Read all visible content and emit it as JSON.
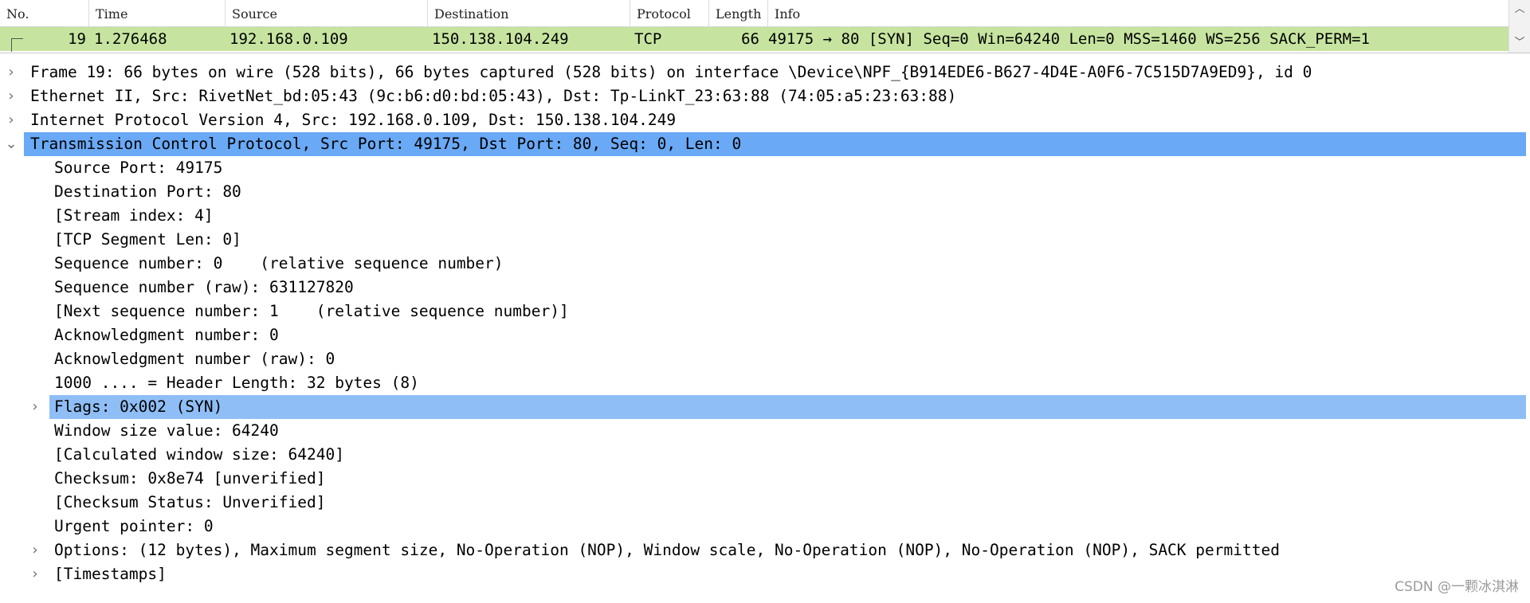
{
  "packet_list": {
    "columns": [
      "No.",
      "Time",
      "Source",
      "Destination",
      "Protocol",
      "Length",
      "Info"
    ],
    "row": {
      "no": "19",
      "time": "1.276468",
      "source": "192.168.0.109",
      "destination": "150.138.104.249",
      "protocol": "TCP",
      "length": "66",
      "info": "49175 → 80 [SYN] Seq=0 Win=64240 Len=0 MSS=1460 WS=256 SACK_PERM=1"
    },
    "row_color": "#c6e4a0",
    "scroll_up_icon": "chevron-up-icon",
    "scroll_down_icon": "chevron-down-icon"
  },
  "details": {
    "frame": "Frame 19: 66 bytes on wire (528 bits), 66 bytes captured (528 bits) on interface \\Device\\NPF_{B914EDE6-B627-4D4E-A0F6-7C515D7A9ED9}, id 0",
    "ethernet": "Ethernet II, Src: RivetNet_bd:05:43 (9c:b6:d0:bd:05:43), Dst: Tp-LinkT_23:63:88 (74:05:a5:23:63:88)",
    "ip": "Internet Protocol Version 4, Src: 192.168.0.109, Dst: 150.138.104.249",
    "tcp": "Transmission Control Protocol, Src Port: 49175, Dst Port: 80, Seq: 0, Len: 0",
    "tcp_fields": [
      "Source Port: 49175",
      "Destination Port: 80",
      "[Stream index: 4]",
      "[TCP Segment Len: 0]",
      "Sequence number: 0    (relative sequence number)",
      "Sequence number (raw): 631127820",
      "[Next sequence number: 1    (relative sequence number)]",
      "Acknowledgment number: 0",
      "Acknowledgment number (raw): 0",
      "1000 .... = Header Length: 32 bytes (8)",
      "Flags: 0x002 (SYN)",
      "Window size value: 64240",
      "[Calculated window size: 64240]",
      "Checksum: 0x8e74 [unverified]",
      "[Checksum Status: Unverified]",
      "Urgent pointer: 0",
      "Options: (12 bytes), Maximum segment size, No-Operation (NOP), Window scale, No-Operation (NOP), No-Operation (NOP), SACK permitted",
      "[Timestamps]"
    ],
    "selected_color": "#6aa9f5",
    "secondary_selected_color": "#8fbef6"
  },
  "watermark": "CSDN @一颗冰淇淋"
}
